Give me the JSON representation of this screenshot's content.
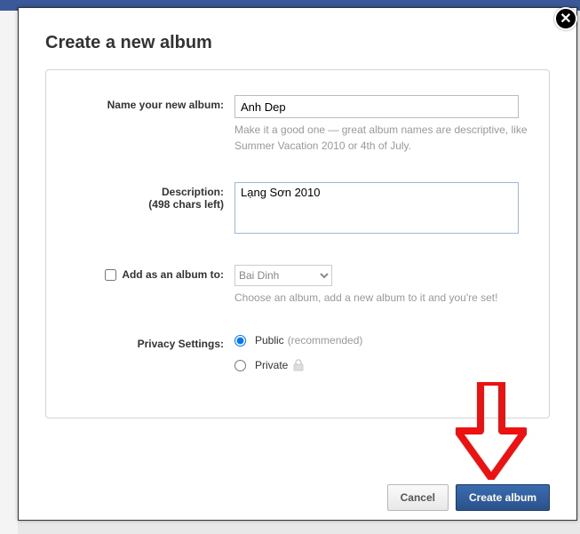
{
  "modal": {
    "title": "Create a new album"
  },
  "name": {
    "label": "Name your new album:",
    "value": "Anh Dep",
    "hint": "Make it a good one — great album names are descriptive, like Summer Vacation 2010 or 4th of July."
  },
  "description": {
    "label": "Description:",
    "chars_left": "(498 chars left)",
    "value": "Lạng Sơn 2010"
  },
  "parent": {
    "label": "Add as an album to:",
    "selected": "Bai Dinh",
    "hint": "Choose an album, add a new album to it and you're set!"
  },
  "privacy": {
    "label": "Privacy Settings:",
    "public_label": "Public",
    "public_rec": "(recommended)",
    "private_label": "Private"
  },
  "buttons": {
    "cancel": "Cancel",
    "create": "Create album"
  }
}
